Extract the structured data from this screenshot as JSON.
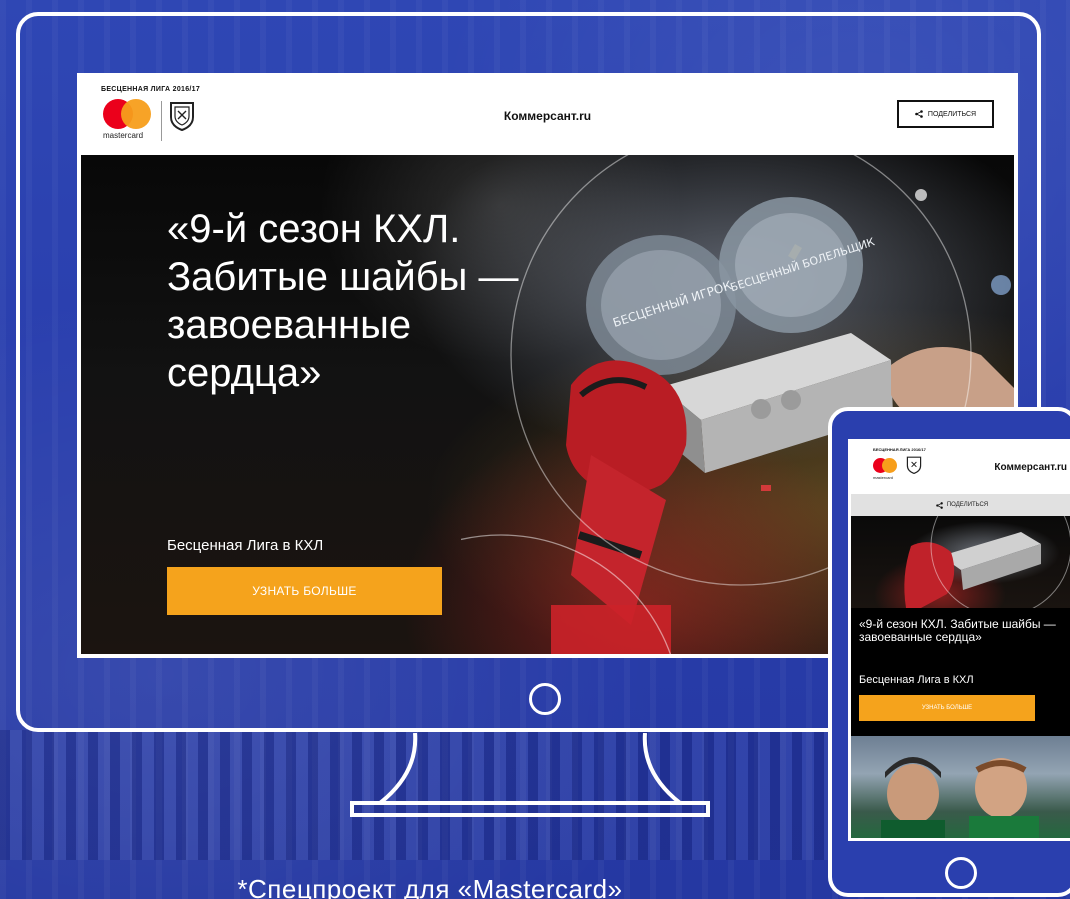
{
  "desktop": {
    "league_label": "БЕСЦЕННАЯ ЛИГА 2016/17",
    "mastercard_text": "mastercard",
    "brand": "Коммерсант.ru",
    "share_label": "ПОДЕЛИТЬСЯ",
    "hero_title": "«9-й сезон КХЛ. Забитые шайбы — завоеванные сердца»",
    "hero_subtitle": "Бесценная Лига в КХЛ",
    "cta_label": "УЗНАТЬ БОЛЬШЕ",
    "puck_left_text": "БЕСЦЕННЫЙ ИГРОК",
    "puck_right_text": "БЕСЦЕННЫЙ БОЛЕЛЬЩИК"
  },
  "mobile": {
    "league_label": "БЕСЦЕННАЯ ЛИГА 2016/17",
    "mastercard_text": "mastercard",
    "brand": "Коммерсант.ru",
    "share_label": "ПОДЕЛИТЬСЯ",
    "hero_title": "«9-й сезон КХЛ. Забитые шайбы — завоеванные сердца»",
    "hero_subtitle": "Бесценная Лига в КХЛ",
    "cta_label": "УЗНАТЬ БОЛЬШЕ"
  },
  "caption": "*Спецпроект для «Mastercard»",
  "colors": {
    "background": "#2a3fae",
    "cta": "#f5a31c",
    "mastercard_red": "#eb001b",
    "mastercard_yellow": "#f79e1b",
    "frame": "#ffffff"
  },
  "icons": {
    "share": "share-icon",
    "khl": "khl-shield-icon",
    "mastercard": "mastercard-logo"
  }
}
